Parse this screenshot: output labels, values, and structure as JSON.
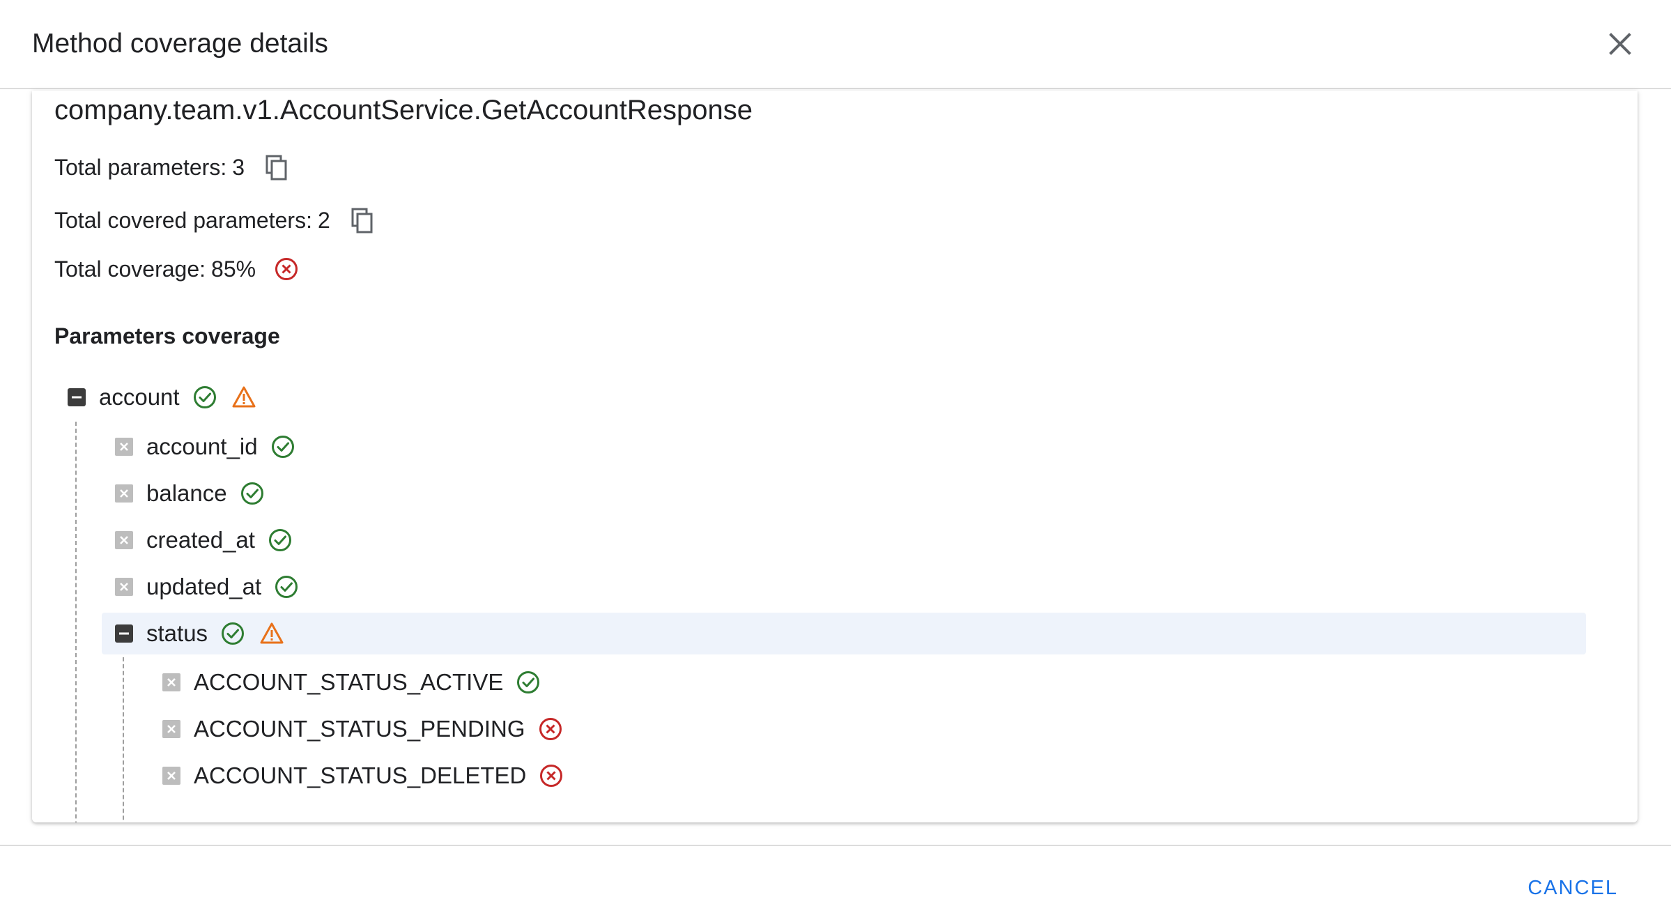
{
  "dialog": {
    "title": "Method coverage details",
    "close_icon": "close-icon",
    "cancel_label": "CANCEL"
  },
  "summary": {
    "message_name": "company.team.v1.AccountService.GetAccountResponse",
    "total_parameters_label": "Total parameters:",
    "total_parameters_value": "3",
    "total_covered_label": "Total covered parameters:",
    "total_covered_value": "2",
    "total_coverage_label": "Total coverage:",
    "total_coverage_value": "85%",
    "total_coverage_status": "error"
  },
  "parameters": {
    "section_title": "Parameters coverage",
    "tree": [
      {
        "label": "account",
        "level": 0,
        "expandable": true,
        "statuses": [
          "ok",
          "warning"
        ]
      },
      {
        "label": "account_id",
        "level": 1,
        "expandable": false,
        "statuses": [
          "ok"
        ]
      },
      {
        "label": "balance",
        "level": 1,
        "expandable": false,
        "statuses": [
          "ok"
        ]
      },
      {
        "label": "created_at",
        "level": 1,
        "expandable": false,
        "statuses": [
          "ok"
        ]
      },
      {
        "label": "updated_at",
        "level": 1,
        "expandable": false,
        "statuses": [
          "ok"
        ]
      },
      {
        "label": "status",
        "level": 1,
        "expandable": true,
        "statuses": [
          "ok",
          "warning"
        ],
        "highlighted": true
      },
      {
        "label": "ACCOUNT_STATUS_ACTIVE",
        "level": 2,
        "expandable": false,
        "statuses": [
          "ok"
        ]
      },
      {
        "label": "ACCOUNT_STATUS_PENDING",
        "level": 2,
        "expandable": false,
        "statuses": [
          "error"
        ]
      },
      {
        "label": "ACCOUNT_STATUS_DELETED",
        "level": 2,
        "expandable": false,
        "statuses": [
          "error"
        ]
      }
    ]
  },
  "colors": {
    "ok": "#2e7d32",
    "warning": "#e8711a",
    "error": "#c62828",
    "accent": "#1a73e8",
    "highlight_row": "#eef3fb"
  }
}
